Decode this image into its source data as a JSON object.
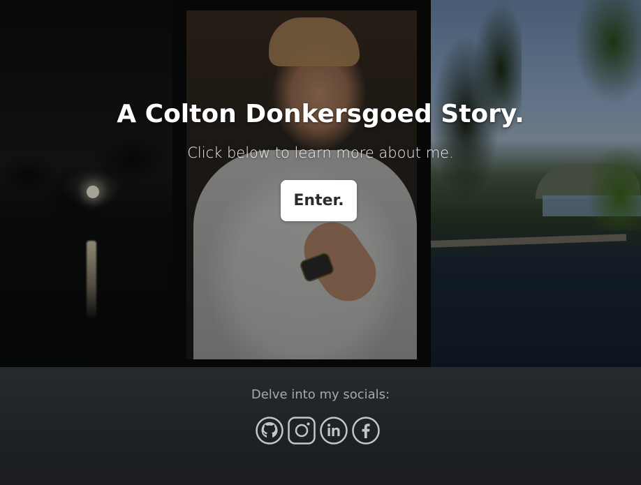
{
  "hero": {
    "title": "A Colton Donkersgoed Story.",
    "subtitle": "Click below to learn more about me.",
    "enter_button_label": "Enter."
  },
  "footer": {
    "label": "Delve into my socials:",
    "socials": [
      {
        "name": "GitHub",
        "icon": "github-icon"
      },
      {
        "name": "Instagram",
        "icon": "instagram-icon"
      },
      {
        "name": "LinkedIn",
        "icon": "linkedin-icon"
      },
      {
        "name": "Facebook",
        "icon": "facebook-icon"
      }
    ]
  },
  "colors": {
    "button_bg": "#ffffff",
    "button_text": "#2b2b2b",
    "footer_bg": "#1f2225",
    "footer_text": "#a7a9ac",
    "icon_color": "#c4c6c8"
  }
}
